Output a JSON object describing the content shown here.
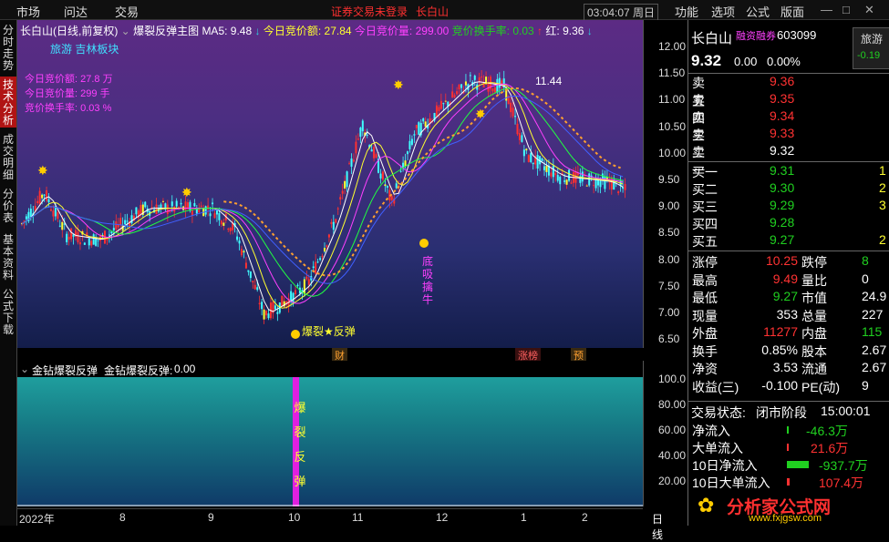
{
  "menu": {
    "market": "市场",
    "qa": "问达",
    "trade": "交易",
    "login": "证券交易未登录",
    "stock": "长白山",
    "time": "03:04:07 周日",
    "func": "功能",
    "options": "选项",
    "formula": "公式",
    "layout": "版面"
  },
  "leftnav": {
    "timeshare": "分时走势",
    "tech": "技术分析",
    "deals": "成交明细",
    "pricetable": "分价表",
    "basic": "基本资料",
    "download": "公式下载"
  },
  "main": {
    "title": "长白山(日线,前复权)",
    "indicator": "爆裂反弹主图",
    "ma5_label": "MA5:",
    "ma5_value": "9.48",
    "amt_label": "今日竞价额:",
    "amt_value": "27.84",
    "vol_label": "今日竞价量:",
    "vol_value": "299.00",
    "turn_label": "竞价换手率:",
    "turn_value": "0.03",
    "red_label": "红:",
    "red_value": "9.36",
    "sectors": "旅游 吉林板块",
    "info1": "今日竞价额: 27.8 万",
    "info2": "今日竞价量: 299 手",
    "info3": "竞价换手率: 0.03 %",
    "high_label": "11.44",
    "low_label": "爆裂★反弹",
    "bottom_label": "底吸擒牛",
    "bao": "爆裂",
    "ind_text": "爆裂反弹",
    "reversal_vertical": "爆裂反弹"
  },
  "events": {
    "cai": "财",
    "cw": "涨榜",
    "yu": "预"
  },
  "axis_main": [
    "12.00",
    "11.50",
    "11.00",
    "10.50",
    "10.00",
    "9.50",
    "9.00",
    "8.50",
    "8.00",
    "7.50",
    "7.00",
    "6.50"
  ],
  "axis_ind": [
    "100.0",
    "80.00",
    "60.00",
    "40.00",
    "20.00"
  ],
  "ind": {
    "title": "金钻爆裂反弹",
    "label": "金钻爆裂反弹:",
    "value": "0.00"
  },
  "xaxis": {
    "year": "2022年",
    "m8": "8",
    "m9": "9",
    "m10": "10",
    "m11": "11",
    "m12": "12",
    "m1": "1",
    "m2": "2",
    "period": "日线"
  },
  "quote": {
    "name": "长白山",
    "tag": "融资融券",
    "code": "603099",
    "price": "9.32",
    "change": "0.00",
    "pct": "0.00%",
    "tab": "旅游",
    "tab_pct": "-0.19",
    "asks": [
      {
        "label": "卖五",
        "price": "9.36"
      },
      {
        "label": "卖四",
        "price": "9.35"
      },
      {
        "label": "卖三",
        "price": "9.34"
      },
      {
        "label": "卖二",
        "price": "9.33"
      },
      {
        "label": "卖一",
        "price": "9.32"
      }
    ],
    "bids": [
      {
        "label": "买一",
        "price": "9.31",
        "vol": "1"
      },
      {
        "label": "买二",
        "price": "9.30",
        "vol": "2"
      },
      {
        "label": "买三",
        "price": "9.29",
        "vol": "3"
      },
      {
        "label": "买四",
        "price": "9.28",
        "vol": ""
      },
      {
        "label": "买五",
        "price": "9.27",
        "vol": "2"
      }
    ],
    "stats": [
      {
        "l1": "涨停",
        "v1": "10.25",
        "l2": "跌停",
        "v2": "8"
      },
      {
        "l1": "最高",
        "v1": "9.49",
        "l2": "量比",
        "v2": "0"
      },
      {
        "l1": "最低",
        "v1": "9.27",
        "l2": "市值",
        "v2": "24.9"
      },
      {
        "l1": "现量",
        "v1": "353",
        "l2": "总量",
        "v2": "227"
      },
      {
        "l1": "外盘",
        "v1": "11277",
        "l2": "内盘",
        "v2": "115"
      },
      {
        "l1": "换手",
        "v1": "0.85%",
        "l2": "股本",
        "v2": "2.67"
      },
      {
        "l1": "净资",
        "v1": "3.53",
        "l2": "流通",
        "v2": "2.67"
      },
      {
        "l1": "收益(三)",
        "v1": "-0.100",
        "l2": "PE(动)",
        "v2": "9"
      }
    ],
    "status_label": "交易状态:",
    "status": "闭市阶段",
    "status_time": "15:00:01",
    "flows": [
      {
        "label": "净流入",
        "value": "-46.3万"
      },
      {
        "label": "大单流入",
        "value": "21.6万"
      },
      {
        "label": "10日净流入",
        "value": "-937.7万"
      },
      {
        "label": "10日大单流入",
        "value": "107.4万"
      }
    ],
    "logo_text": "分析家公式网",
    "logo_url": "www.fxjgsw.com"
  },
  "colors": {
    "up": "#ff3232",
    "down": "#20d020",
    "accent": "#ffff30"
  }
}
